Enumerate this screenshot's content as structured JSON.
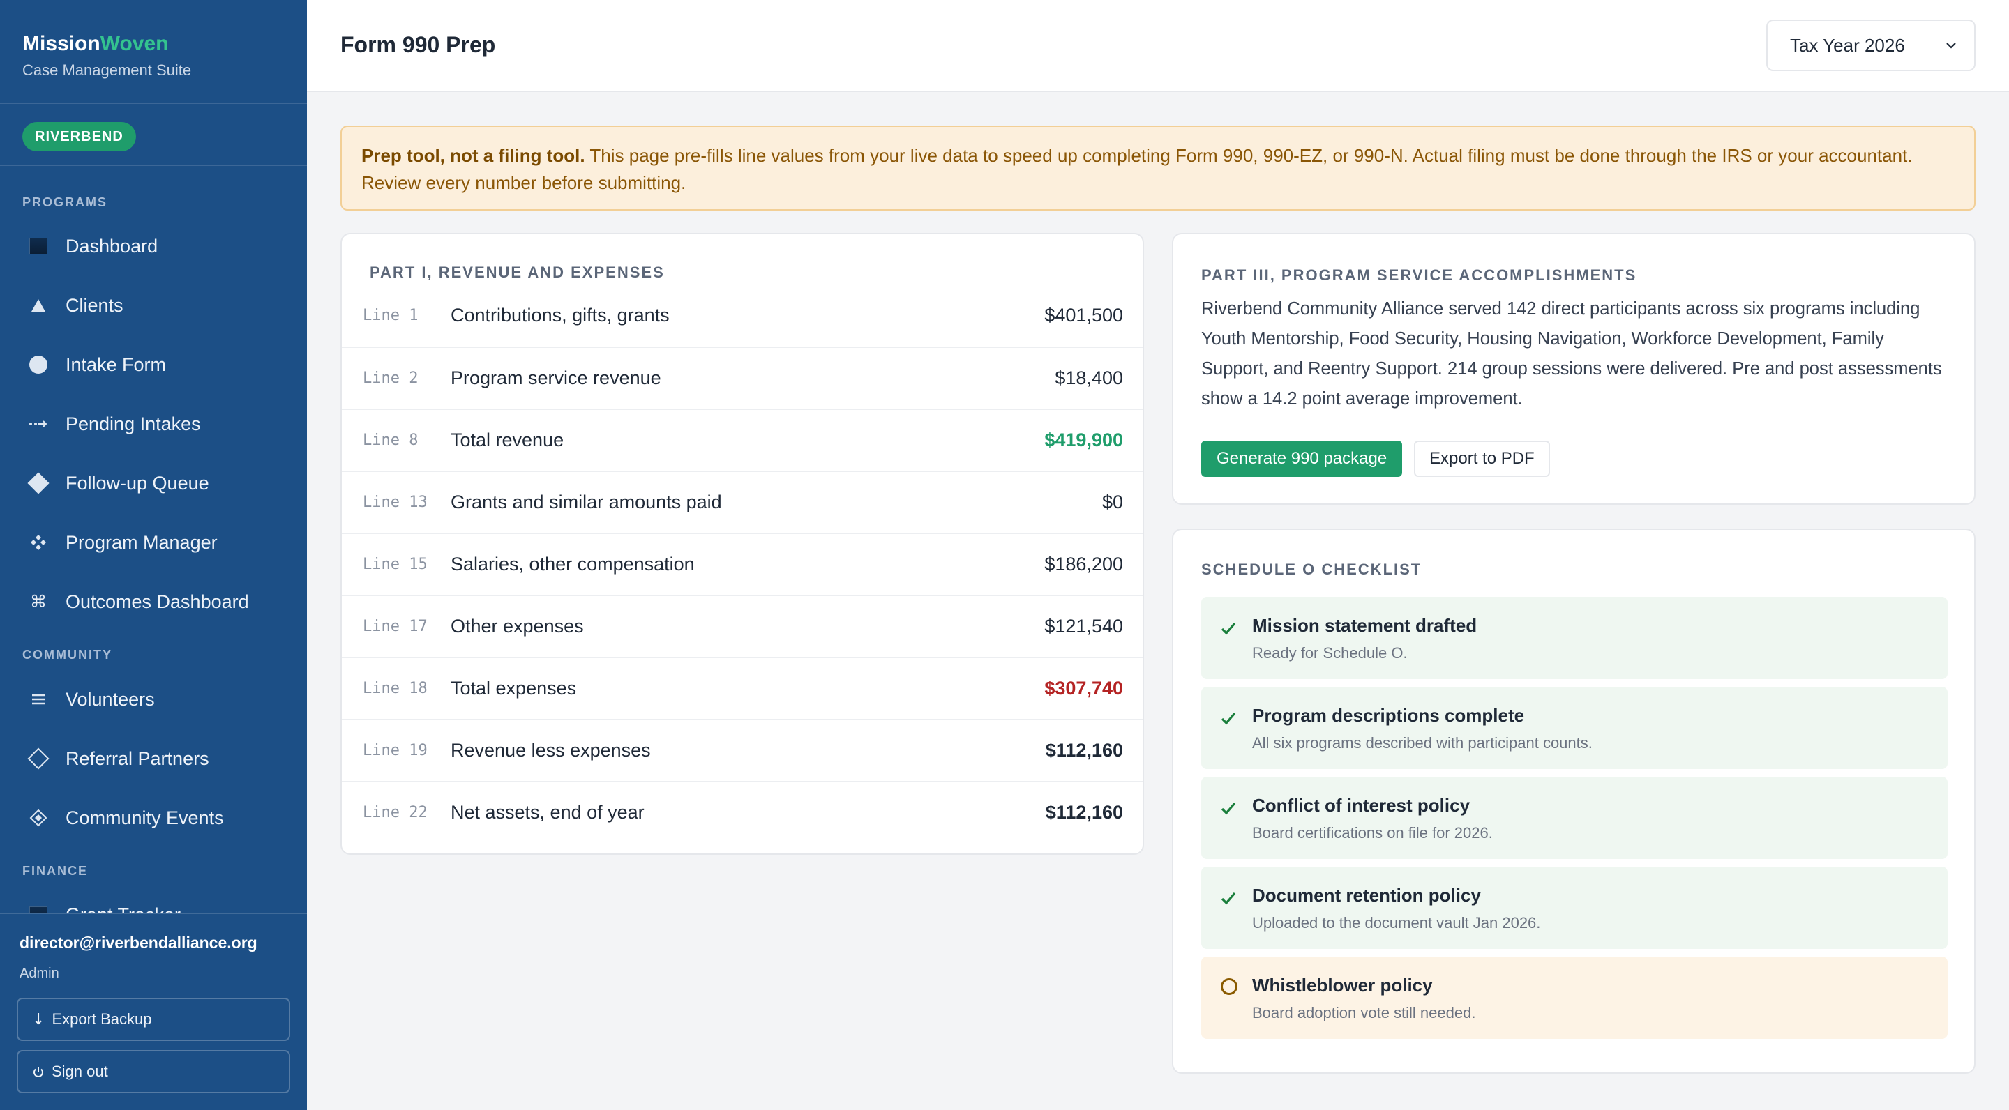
{
  "sidebar": {
    "brand_main": "Mission",
    "brand_accent": "Woven",
    "brand_sub": "Case Management Suite",
    "org_badge": "RIVERBEND",
    "sections": {
      "programs": "PROGRAMS",
      "community": "COMMUNITY",
      "finance": "FINANCE"
    },
    "items": [
      {
        "label": "Dashboard",
        "icon": "dashboard-icon"
      },
      {
        "label": "Clients",
        "icon": "triangle-icon"
      },
      {
        "label": "Intake Form",
        "icon": "circle-icon"
      },
      {
        "label": "Pending Intakes",
        "icon": "dotted-arrow-icon"
      },
      {
        "label": "Follow-up Queue",
        "icon": "diamond-icon"
      },
      {
        "label": "Program Manager",
        "icon": "four-diamond-icon"
      },
      {
        "label": "Outcomes Dashboard",
        "icon": "command-icon"
      },
      {
        "label": "Volunteers",
        "icon": "menu-lines-icon"
      },
      {
        "label": "Referral Partners",
        "icon": "diamond-outline-icon"
      },
      {
        "label": "Community Events",
        "icon": "diamond-dot-icon"
      },
      {
        "label": "Grant Tracker",
        "icon": "grant-icon"
      }
    ],
    "user_email": "director@riverbendalliance.org",
    "user_role": "Admin",
    "export_backup": "Export Backup",
    "sign_out": "Sign out"
  },
  "header": {
    "title": "Form 990 Prep",
    "tax_year": "Tax Year 2026"
  },
  "notice": {
    "bold": "Prep tool, not a filing tool.",
    "text": " This page pre-fills line values from your live data to speed up completing Form 990, 990-EZ, or 990-N. Actual filing must be done through the IRS or your accountant. Review every number before submitting."
  },
  "part1": {
    "title": "PART I, REVENUE AND EXPENSES",
    "rows": [
      {
        "line": "Line 1",
        "desc": "Contributions, gifts, grants",
        "value": "$401,500"
      },
      {
        "line": "Line 2",
        "desc": "Program service revenue",
        "value": "$18,400"
      },
      {
        "line": "Line 8",
        "desc": "Total revenue",
        "value": "$419,900"
      },
      {
        "line": "Line 13",
        "desc": "Grants and similar amounts paid",
        "value": "$0"
      },
      {
        "line": "Line 15",
        "desc": "Salaries, other compensation",
        "value": "$186,200"
      },
      {
        "line": "Line 17",
        "desc": "Other expenses",
        "value": "$121,540"
      },
      {
        "line": "Line 18",
        "desc": "Total expenses",
        "value": "$307,740"
      },
      {
        "line": "Line 19",
        "desc": "Revenue less expenses",
        "value": "$112,160"
      },
      {
        "line": "Line 22",
        "desc": "Net assets, end of year",
        "value": "$112,160"
      }
    ]
  },
  "part3": {
    "title": "PART III, PROGRAM SERVICE ACCOMPLISHMENTS",
    "text": "Riverbend Community Alliance served 142 direct participants across six programs including Youth Mentorship, Food Security, Housing Navigation, Workforce Development, Family Support, and Reentry Support. 214 group sessions were delivered. Pre and post assessments show a 14.2 point average improvement.",
    "generate_btn": "Generate 990 package",
    "export_btn": "Export to PDF"
  },
  "schedule_o": {
    "title": "SCHEDULE O CHECKLIST",
    "items": [
      {
        "title": "Mission statement drafted",
        "sub": "Ready for Schedule O.",
        "done": true
      },
      {
        "title": "Program descriptions complete",
        "sub": "All six programs described with participant counts.",
        "done": true
      },
      {
        "title": "Conflict of interest policy",
        "sub": "Board certifications on file for 2026.",
        "done": true
      },
      {
        "title": "Document retention policy",
        "sub": "Uploaded to the document vault Jan 2026.",
        "done": true
      },
      {
        "title": "Whistleblower policy",
        "sub": "Board adoption vote still needed.",
        "done": false
      }
    ]
  },
  "colors": {
    "sidebar": "#1c4f86",
    "accent_green": "#1f9d6b",
    "expense_red": "#b42323",
    "notice_bg": "#fcefdc"
  }
}
